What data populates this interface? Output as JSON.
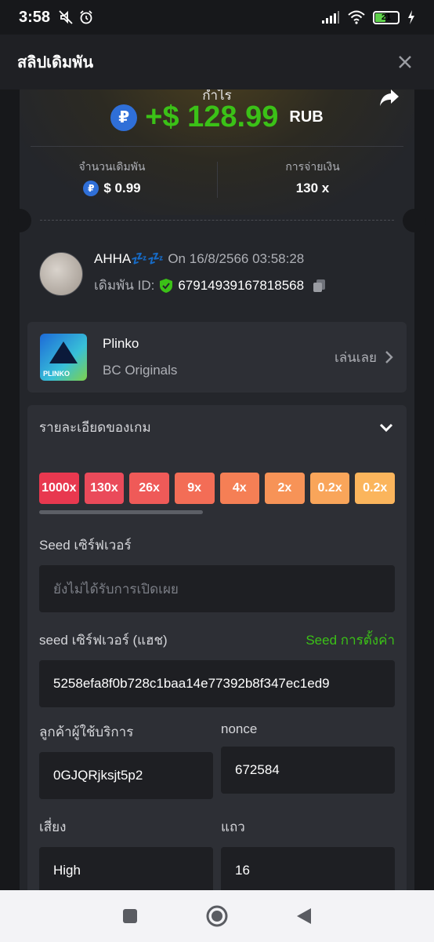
{
  "status_bar": {
    "time": "3:58",
    "battery_level": "21",
    "icons": [
      "mute-icon",
      "alarm-icon",
      "signal-icon",
      "wifi-icon",
      "battery-icon",
      "charging-icon"
    ]
  },
  "header": {
    "title": "สลิปเดิมพัน",
    "close_icon": "close-icon"
  },
  "summary": {
    "profit_label": "กำไร",
    "profit_amount": "+$ 128.99",
    "profit_currency": "RUB",
    "bet_amount_label": "จำนวนเดิมพัน",
    "bet_amount_value": "$ 0.99",
    "payout_label": "การจ่ายเงิน",
    "payout_value": "130 x",
    "coin_symbol": "₽",
    "profit_color": "#3bc117"
  },
  "user": {
    "name": "AHHA💤💤",
    "date_prefix": "On",
    "datetime": "16/8/2566 03:58:28",
    "bet_id_label": "เดิมพัน ID:",
    "bet_id": "67914939167818568"
  },
  "game": {
    "name": "Plinko",
    "provider": "BC Originals",
    "play_label": "เล่นเลย",
    "thumb_text": "PLINKO"
  },
  "details": {
    "title": "รายละเอียดของเกม",
    "multipliers": [
      {
        "label": "1000x",
        "color": "#e8384f"
      },
      {
        "label": "130x",
        "color": "#ea4a5a"
      },
      {
        "label": "26x",
        "color": "#ef5a58"
      },
      {
        "label": "9x",
        "color": "#f36d56"
      },
      {
        "label": "4x",
        "color": "#f57f55"
      },
      {
        "label": "2x",
        "color": "#f79357"
      },
      {
        "label": "0.2x",
        "color": "#f9a55a"
      },
      {
        "label": "0.2x",
        "color": "#fbb55c"
      }
    ],
    "server_seed_label": "Seed เซิร์ฟเวอร์",
    "server_seed_placeholder": "ยังไม่ได้รับการเปิดเผย",
    "server_seed_hash_label": "seed เซิร์ฟเวอร์ (แฮช)",
    "seed_settings_label": "Seed การตั้งค่า",
    "server_seed_hash": "5258efa8f0b728c1baa14e77392b8f347ec1ed9",
    "client_label": "ลูกค้าผู้ใช้บริการ",
    "client_seed": "0GJQRjksjt5p2",
    "nonce_label": "nonce",
    "nonce": "672584",
    "risk_label": "เสี่ยง",
    "risk": "High",
    "rows_label": "แถว",
    "rows": "16"
  },
  "nav": {
    "icons": [
      "recent-apps-icon",
      "home-icon",
      "back-icon"
    ]
  }
}
